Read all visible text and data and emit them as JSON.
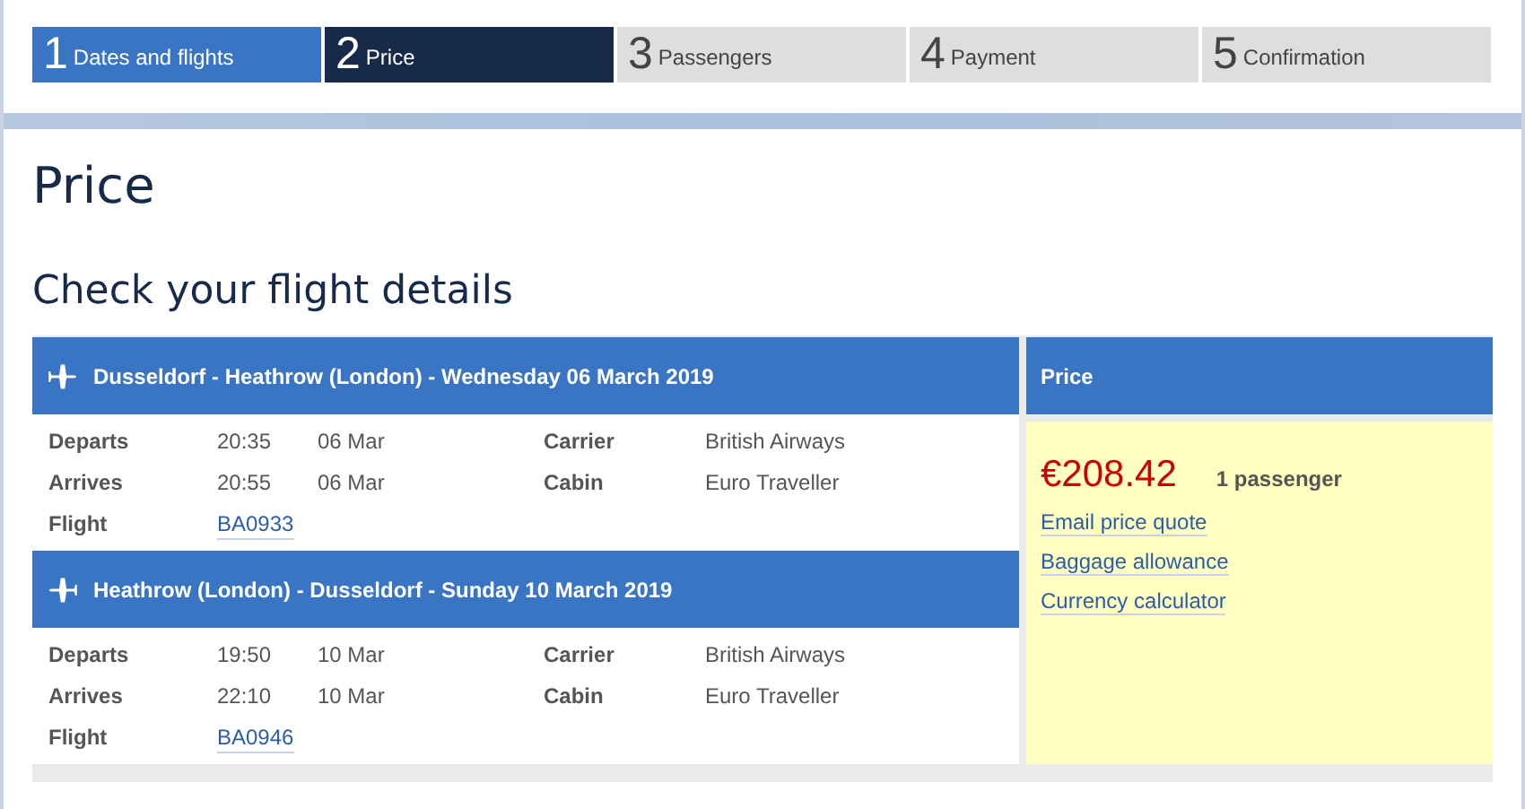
{
  "steps": [
    {
      "number": "1",
      "label": "Dates and flights",
      "completed": true,
      "selected": false
    },
    {
      "number": "2",
      "label": "Price",
      "completed": false,
      "selected": true
    },
    {
      "number": "3",
      "label": "Passengers",
      "completed": false,
      "selected": false
    },
    {
      "number": "4",
      "label": "Payment",
      "completed": false,
      "selected": false
    },
    {
      "number": "5",
      "label": "Confirmation",
      "completed": false,
      "selected": false
    }
  ],
  "page_title": "Price",
  "section_title": "Check your flight details",
  "flights": [
    {
      "route": "Dusseldorf - Heathrow (London) - Wednesday 06 March 2019",
      "kind": "outbound",
      "departs_label": "Departs",
      "departs_time": "20:35",
      "departs_date": "06 Mar",
      "arrives_label": "Arrives",
      "arrives_time": "20:55",
      "arrives_date": "06 Mar",
      "flight_label": "Flight",
      "flight_number": "BA0933",
      "carrier_label": "Carrier",
      "carrier": "British Airways",
      "cabin_label": "Cabin",
      "cabin": "Euro Traveller"
    },
    {
      "route": "Heathrow (London) - Dusseldorf - Sunday 10 March 2019",
      "kind": "return",
      "departs_label": "Departs",
      "departs_time": "19:50",
      "departs_date": "10 Mar",
      "arrives_label": "Arrives",
      "arrives_time": "22:10",
      "arrives_date": "10 Mar",
      "flight_label": "Flight",
      "flight_number": "BA0946",
      "carrier_label": "Carrier",
      "carrier": "British Airways",
      "cabin_label": "Cabin",
      "cabin": "Euro Traveller"
    }
  ],
  "price_panel": {
    "heading": "Price",
    "amount": "€208.42",
    "passengers": "1 passenger",
    "links": [
      "Email price quote",
      "Baggage allowance",
      "Currency calculator"
    ]
  }
}
